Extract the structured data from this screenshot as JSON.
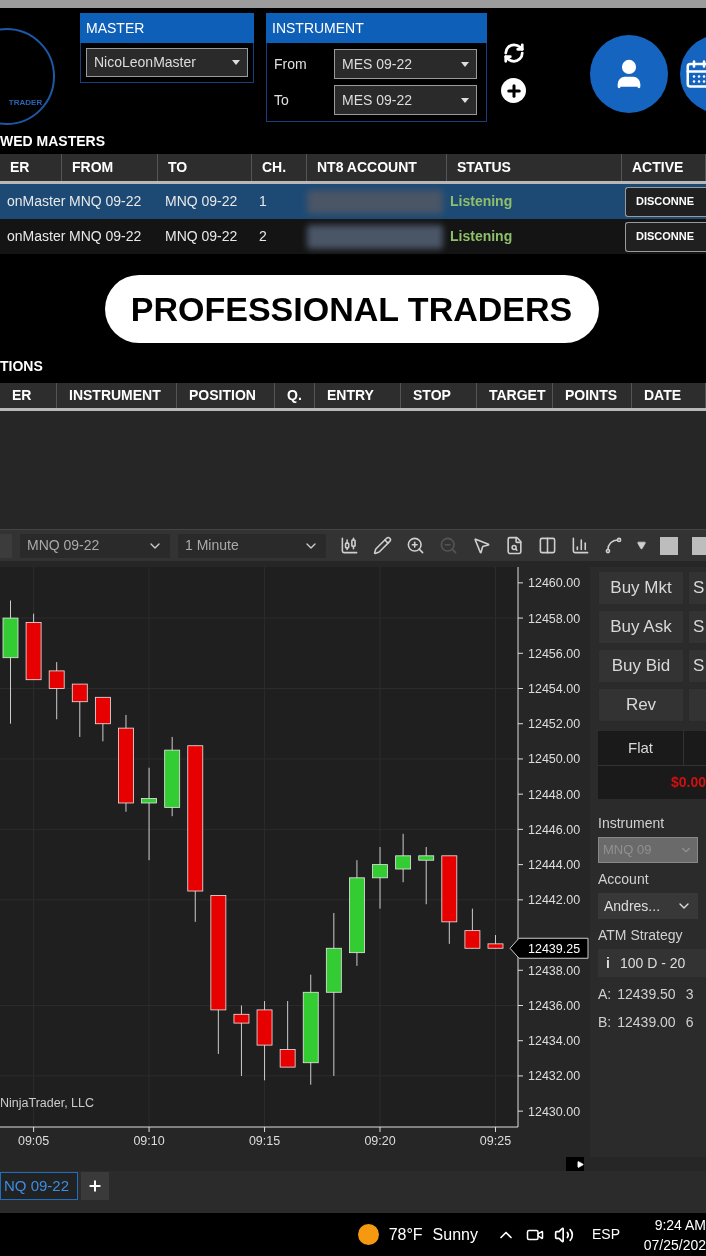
{
  "logo": {
    "text": "TRADER"
  },
  "master": {
    "label": "MASTER",
    "value": "NicoLeonMaster"
  },
  "instrument": {
    "label": "INSTRUMENT",
    "fields": [
      {
        "label": "From",
        "value": "MES 09-22"
      },
      {
        "label": "To",
        "value": "MES 09-22"
      }
    ]
  },
  "followed_masters": {
    "title": "WED MASTERS",
    "columns": [
      "ER",
      "FROM",
      "TO",
      "CH.",
      "NT8 ACCOUNT",
      "STATUS",
      "ACTIVE"
    ],
    "rows": [
      {
        "master": "onMaster",
        "from": "MNQ 09-22",
        "to": "MNQ 09-22",
        "ch": "1",
        "status": "Listening",
        "action": "DISCONNE",
        "selected": true
      },
      {
        "master": "onMaster",
        "from": "MNQ 09-22",
        "to": "MNQ 09-22",
        "ch": "2",
        "status": "Listening",
        "action": "DISCONNE",
        "selected": false
      }
    ]
  },
  "caption": "PROFESSIONAL TRADERS",
  "positions": {
    "title": "TIONS",
    "columns": [
      "ER",
      "INSTRUMENT",
      "POSITION",
      "Q.",
      "ENTRY",
      "STOP",
      "TARGET",
      "POINTS",
      "DATE"
    ]
  },
  "chart_toolbar": {
    "instrument": "MNQ 09-22",
    "interval": "1 Minute"
  },
  "chart": {
    "watermark": "NinjaTrader, LLC",
    "last_price": "12439.25",
    "chart_data": {
      "type": "candlestick",
      "grid": true,
      "categories": [
        null,
        "09:05",
        null,
        null,
        null,
        null,
        "09:10",
        null,
        null,
        null,
        null,
        "09:15",
        null,
        null,
        null,
        null,
        "09:20",
        null,
        null,
        null,
        null,
        "09:25"
      ],
      "ohlc": [
        [
          12455.75,
          12459,
          12452,
          12458
        ],
        [
          12457.75,
          12458.25,
          12454.5,
          12454.5
        ],
        [
          12455,
          12455.5,
          12452.25,
          12454
        ],
        [
          12454.25,
          12454.25,
          12451.25,
          12453.25
        ],
        [
          12453.5,
          12453.5,
          12451,
          12452
        ],
        [
          12451.75,
          12452.5,
          12447,
          12447.5
        ],
        [
          12447.5,
          12449.5,
          12444.25,
          12447.75
        ],
        [
          12447.25,
          12451.25,
          12446.75,
          12450.5
        ],
        [
          12450.75,
          12450.75,
          12440.75,
          12442.5
        ],
        [
          12442.25,
          12442.25,
          12433.25,
          12435.75
        ],
        [
          12435.5,
          12436,
          12432,
          12435
        ],
        [
          12435.75,
          12436.25,
          12431.75,
          12433.75
        ],
        [
          12433.5,
          12436.25,
          12432.5,
          12432.5
        ],
        [
          12432.75,
          12437.75,
          12431.5,
          12436.75
        ],
        [
          12436.75,
          12441.25,
          12432,
          12439.25
        ],
        [
          12439,
          12444.25,
          12438.25,
          12443.25
        ],
        [
          12443.25,
          12445,
          12441.5,
          12444
        ],
        [
          12443.75,
          12445.75,
          12443,
          12444.5
        ],
        [
          12444.25,
          12445,
          12441.75,
          12444.5
        ],
        [
          12444.5,
          12444.5,
          12439.5,
          12440.75
        ],
        [
          12440.25,
          12441.5,
          12439.25,
          12439.25
        ],
        [
          12439.5,
          12440,
          12439.25,
          12439.25
        ]
      ],
      "ylim": [
        12429.1,
        12460.9
      ],
      "yticks": [
        {
          "value": 12430,
          "label": "12430.00"
        },
        {
          "value": 12432,
          "label": "12432.00"
        },
        {
          "value": 12434,
          "label": "12434.00"
        },
        {
          "value": 12436,
          "label": "12436.00"
        },
        {
          "value": 12438,
          "label": "12438.00"
        },
        {
          "value": 12442,
          "label": "12442.00"
        },
        {
          "value": 12444,
          "label": "12444.00"
        },
        {
          "value": 12446,
          "label": "12446.00"
        },
        {
          "value": 12448,
          "label": "12448.00"
        },
        {
          "value": 12450,
          "label": "12450.00"
        },
        {
          "value": 12452,
          "label": "12452.00"
        },
        {
          "value": 12454,
          "label": "12454.00"
        },
        {
          "value": 12456,
          "label": "12456.00"
        },
        {
          "value": 12458,
          "label": "12458.00"
        },
        {
          "value": 12460,
          "label": "12460.00"
        }
      ]
    }
  },
  "order_panel": {
    "buttons": [
      {
        "left": "Buy Mkt",
        "right": "S"
      },
      {
        "left": "Buy Ask",
        "right": "S"
      },
      {
        "left": "Buy Bid",
        "right": "S"
      },
      {
        "left": "Rev"
      }
    ],
    "position": "Flat",
    "pnl": "$0.00",
    "instrument_label": "Instrument",
    "instrument_value": "MNQ 09",
    "instrument_disabled": true,
    "account_label": "Account",
    "account_value": "Andres...",
    "atm_label": "ATM Strategy",
    "atm_info": "i",
    "atm_value": "100 D - 20",
    "quotes": [
      {
        "side": "A:",
        "price": "12439.50",
        "size": "3"
      },
      {
        "side": "B:",
        "price": "12439.00",
        "size": "6"
      }
    ]
  },
  "tabs": [
    {
      "label": "NQ 09-22",
      "selected": true
    }
  ],
  "taskbar": {
    "temperature": "78°F",
    "weather": "Sunny",
    "language": "ESP",
    "time": "9:24 AM",
    "date": "07/25/202"
  }
}
